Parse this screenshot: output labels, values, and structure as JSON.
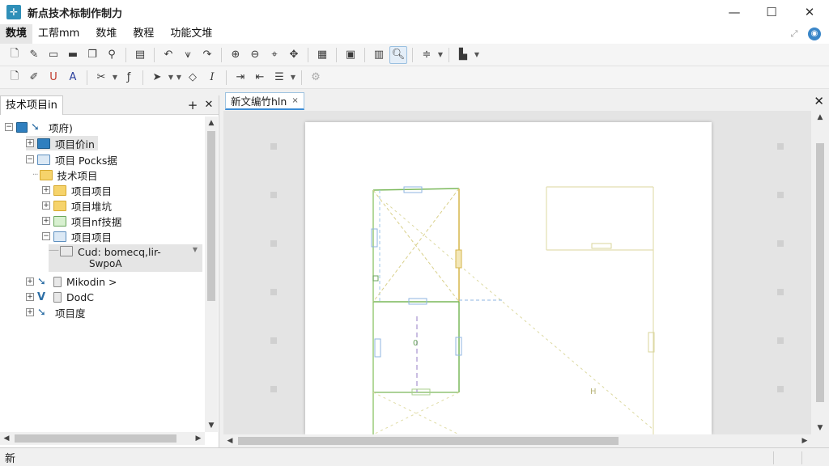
{
  "window": {
    "title": "新点技术标制作制力",
    "controls": {
      "minimize": "—",
      "maximize": "☐",
      "close": "✕"
    }
  },
  "menu": {
    "items": [
      "数境",
      "工帮mm",
      "数堆",
      "教程",
      "功能文堆"
    ]
  },
  "left_panel": {
    "tab_label": "技术项目in",
    "add_label": "+",
    "close_label": "✕",
    "tree": {
      "root": "项府)",
      "items": [
        {
          "label": "项目价in",
          "icon": "proj-icon"
        },
        {
          "label": "项目 Pocks据",
          "icon": "folder-icon"
        },
        {
          "label": "技术项目",
          "icon": "folder-icon"
        },
        {
          "label": "项目项目",
          "icon": "folder-icon"
        },
        {
          "label": "项目堆坑",
          "icon": "folder-icon"
        },
        {
          "label": "项目nf技据",
          "icon": "folder-icon"
        },
        {
          "label": "项目项目",
          "icon": "folder-icon"
        },
        {
          "label": "Cud: bomecq,lir-",
          "sub": "SwpoA",
          "icon": "doc-icon"
        },
        {
          "label": "Mikodin >",
          "icon": "doc-icon"
        },
        {
          "label": "DodC",
          "icon": "doc-icon"
        },
        {
          "label": "项目度",
          "icon": "arrow-icon"
        }
      ]
    }
  },
  "document": {
    "tab_label": "新文编竹hln",
    "tab_close": "×",
    "pane_close": "✕"
  },
  "drawing": {
    "labels": {
      "center": "0",
      "right_small": "H"
    }
  },
  "status": {
    "text": "新"
  },
  "colors": {
    "accent": "#3c8dd6",
    "green_line": "#7ab85a",
    "yellow_line": "#d6b64a",
    "blue_dash": "#8fb6e0"
  }
}
